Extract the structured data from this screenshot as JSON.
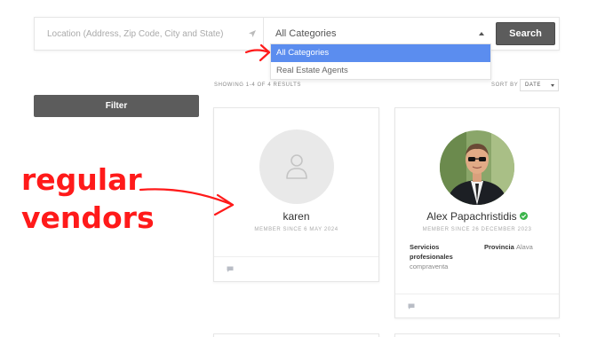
{
  "search": {
    "location_placeholder": "Location (Address, Zip Code, City and State)",
    "category_selected": "All Categories",
    "search_label": "Search"
  },
  "dropdown": {
    "options": [
      "All Categories",
      "Real Estate Agents"
    ]
  },
  "filter": {
    "label": "Filter"
  },
  "results": {
    "summary": "SHOWING 1-4 OF 4 RESULTS",
    "sort_label": "SORT BY",
    "sort_value": "DATE"
  },
  "vendors": [
    {
      "name": "karen",
      "member_since": "MEMBER SINCE 6 MAY 2024",
      "verified": false
    },
    {
      "name": "Alex Papachristidis",
      "member_since": "MEMBER SINCE 26 DECEMBER 2023",
      "verified": true,
      "fields": {
        "services_label_line1": "Servicios",
        "services_label_line2": "profesionales",
        "services_value": "compraventa",
        "province_label": "Provincia",
        "province_value": "Alava"
      }
    }
  ],
  "annotation": {
    "line1": "regular",
    "line2": "vendors",
    "color": "#ff1a1a"
  },
  "colors": {
    "accent_button": "#5c5c5c",
    "dropdown_highlight": "#5b8def",
    "verified": "#3bb54a"
  }
}
